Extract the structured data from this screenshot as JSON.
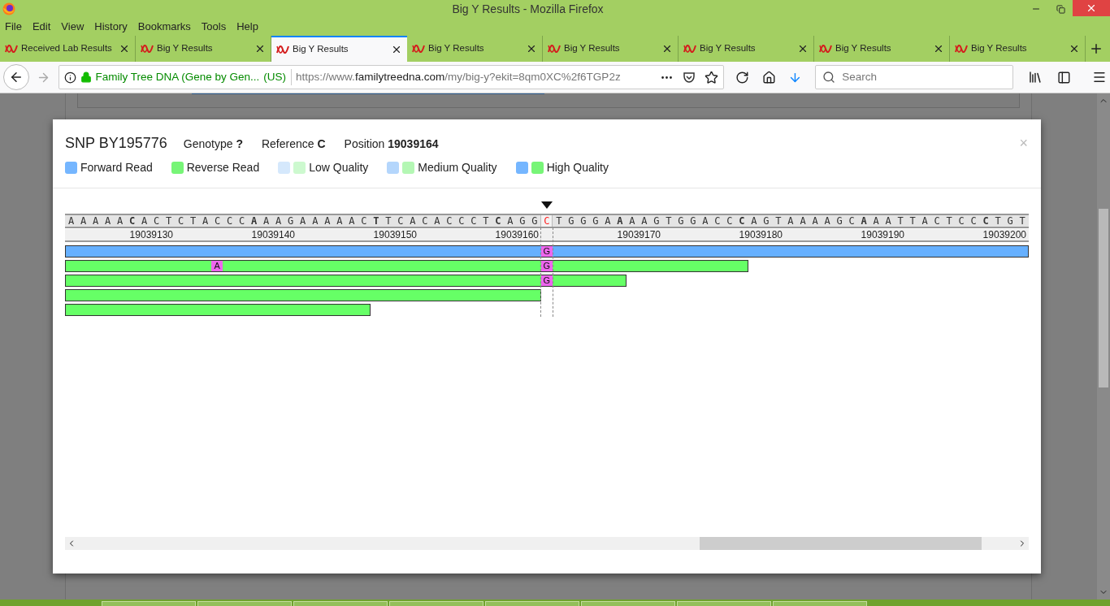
{
  "window": {
    "title": "Big Y Results - Mozilla Firefox"
  },
  "menu": [
    "File",
    "Edit",
    "View",
    "History",
    "Bookmarks",
    "Tools",
    "Help"
  ],
  "tabs": [
    {
      "label": "Received Lab Results",
      "selected": false
    },
    {
      "label": "Big Y Results",
      "selected": false
    },
    {
      "label": "Big Y Results",
      "selected": true
    },
    {
      "label": "Big Y Results",
      "selected": false
    },
    {
      "label": "Big Y Results",
      "selected": false
    },
    {
      "label": "Big Y Results",
      "selected": false
    },
    {
      "label": "Big Y Results",
      "selected": false
    },
    {
      "label": "Big Y Results",
      "selected": false
    }
  ],
  "address_bar": {
    "site_name": "Family Tree DNA (Gene by Gen...",
    "site_country": "(US)",
    "url_prefix": "https://www.",
    "url_domain": "familytreedna.com",
    "url_path": "/my/big-y?ekit=8qm0XC%2f6TGP2z"
  },
  "search": {
    "placeholder": "Search"
  },
  "dialog": {
    "title": "SNP BY195776",
    "close": "×",
    "facts": [
      "Genotype **?**",
      "Reference **C**",
      "Position **19039164**"
    ],
    "legend": [
      {
        "label": "Forward Read",
        "swatches": [
          {
            "color": "#75b6ff"
          }
        ]
      },
      {
        "label": "Reverse Read",
        "swatches": [
          {
            "color": "#77f577"
          }
        ]
      },
      {
        "label": "Low Quality",
        "swatches": [
          {
            "color": "#d5e8fc"
          },
          {
            "color": "#cdf9cf"
          }
        ]
      },
      {
        "label": "Medium Quality",
        "swatches": [
          {
            "color": "#b4d6fc"
          },
          {
            "color": "#b4f7b4"
          }
        ]
      },
      {
        "label": "High Quality",
        "swatches": [
          {
            "color": "#75b6ff"
          },
          {
            "color": "#77f577"
          }
        ]
      }
    ],
    "sequence_left": "AAAAA**C**ACTCTACCC**A**AAGAAAAAC**T**TCACACCCT**C**AGG",
    "reference_base": "C",
    "sequence_right": "TGGGA**A**AAGTGGACC**C**AGTAAAAGC**A**AATTACTCC**C**TGT",
    "ruler": [
      "19039130",
      "19039140",
      "19039150",
      "19039160",
      "19039170",
      "19039180",
      "19039190",
      "19039200"
    ],
    "reads": [
      {
        "kind": "forward",
        "level": 1,
        "mismatches": [
          {
            "base": "G",
            "level": 0.494
          }
        ]
      },
      {
        "kind": "reverse",
        "level": 0.709,
        "mismatches": [
          {
            "base": "A",
            "level": 0.152
          },
          {
            "base": "G",
            "level": 0.494
          }
        ]
      },
      {
        "kind": "reverse",
        "level": 0.583,
        "mismatches": [
          {
            "base": "G",
            "level": 0.494
          }
        ]
      },
      {
        "kind": "reverse",
        "level": 0.494
      },
      {
        "kind": "reverse",
        "level": 0.317
      }
    ]
  }
}
